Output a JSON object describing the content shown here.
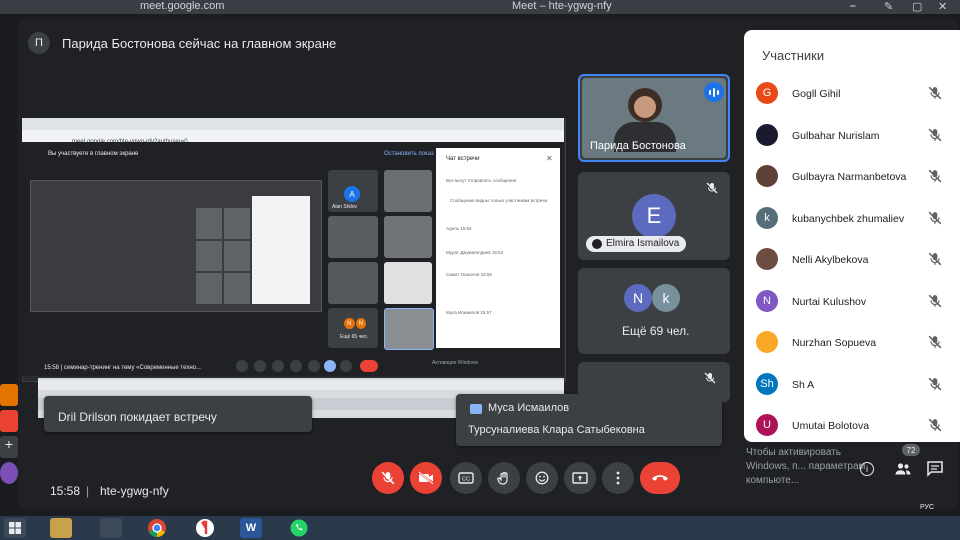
{
  "browser": {
    "url": "meet.google.com",
    "window_title": "Meet – hte-ygwg-nfy"
  },
  "presentation": {
    "presenter_initial": "П",
    "banner": "Парида Бостонова сейчас на главном экране"
  },
  "speaker": {
    "name": "Парида Бостонова"
  },
  "tiles": {
    "e_initial": "E",
    "e_name": "Elmira Ismailova",
    "more_initials": [
      "N",
      "k"
    ],
    "more_label": "Ещё 69 чел."
  },
  "toasts": {
    "leave": "Dril Drilson покидает встречу",
    "message_sender": "Муса Исмаилов",
    "message_text": "Турсуналиева Клара Сатыбековна"
  },
  "participants": {
    "title": "Участники",
    "items": [
      {
        "name": "Gogll Gihil",
        "initial": "G",
        "color": "#e64a19"
      },
      {
        "name": "Gulbahar Nurislam",
        "initial": "",
        "color": "#1a1a2e"
      },
      {
        "name": "Gulbayra Narmanbetova",
        "initial": "",
        "color": "#5d4037"
      },
      {
        "name": "kubanychbek zhumaliev",
        "initial": "k",
        "color": "#546e7a"
      },
      {
        "name": "Nelli Akylbekova",
        "initial": "",
        "color": "#6d4c41"
      },
      {
        "name": "Nurtai Kulushov",
        "initial": "N",
        "color": "#7e57c2"
      },
      {
        "name": "Nurzhan Sopueva",
        "initial": "",
        "color": "#f9a825"
      },
      {
        "name": "Sh A",
        "initial": "Sh",
        "color": "#0277bd"
      },
      {
        "name": "Umutai Bolotova",
        "initial": "U",
        "color": "#ad1457"
      }
    ]
  },
  "bottom": {
    "time": "15:58",
    "separator": "|",
    "meeting_code": "hte-ygwg-nfy",
    "windows_activation": "Чтобы активировать Windows, п... параметрам компьюте...",
    "participant_badge": "72"
  },
  "inner_screen": {
    "url": "meet.google.com/hte-ygwg-nfy?authuser=0",
    "presenting": "Вы участвуете в главном экране",
    "stop": "Остановить показ",
    "chat_title": "Чат встречи",
    "chat_lines": [
      "Все могут отправлять сообщения",
      "Сообщения видны только участникам встречи.",
      "Адель 15:54",
      "Мурат Джумагелдиев 15:54",
      "Самат Осмонов 15:55",
      "Муса Исмаилов 15:57"
    ],
    "mini_initial": "A",
    "mini_name": "Alan Shilov",
    "mini_more": "Ещё 65 чел.",
    "mini_n": "N",
    "time_line": "15:58 | семинар-тренинг на тему «Современные техно...",
    "activation": "Активация Windows"
  },
  "taskbar": {
    "word": "W",
    "lang": "РУС"
  },
  "colors": {
    "meet_bg": "#202124",
    "accent": "#1a73e8",
    "danger": "#ea4335"
  }
}
